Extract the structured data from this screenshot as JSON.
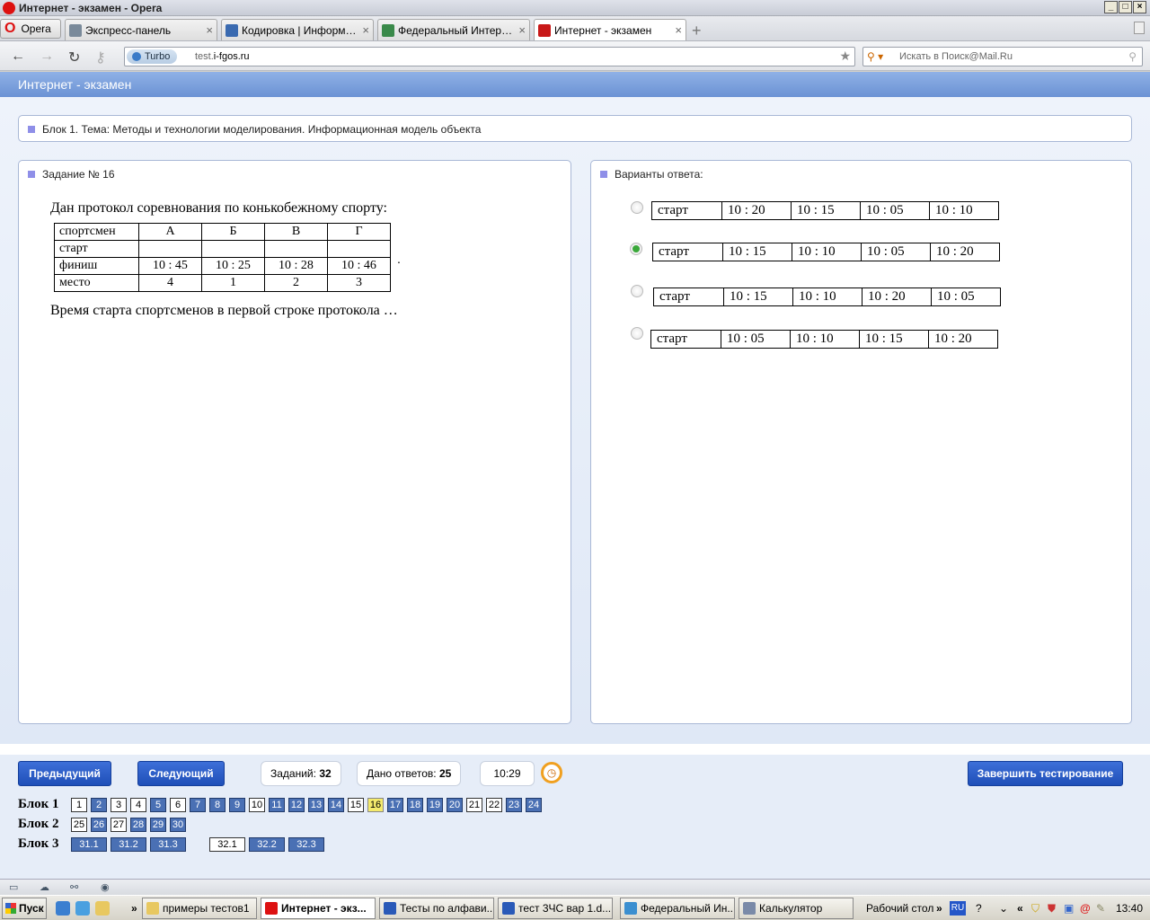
{
  "window": {
    "title": "Интернет - экзамен - Opera"
  },
  "browser": {
    "menu_label": "Opera",
    "tabs": [
      {
        "label": "Экспресс-панель",
        "icon": "grid-icon"
      },
      {
        "label": "Кодировка | Информат...",
        "icon": "site-icon"
      },
      {
        "label": "Федеральный Интерне...",
        "icon": "site-icon"
      },
      {
        "label": "Интернет - экзамен",
        "icon": "site-icon",
        "active": true
      }
    ],
    "turbo_label": "Turbo",
    "url_prefix": "test.",
    "url_domain": "i-fgos.ru",
    "search_placeholder": "Искать в Поиск@Mail.Ru"
  },
  "page": {
    "header_title": "Интернет - экзамен",
    "block_title": "Блок 1. Тема: Методы и технологии моделирования. Информационная модель объекта",
    "task_title": "Задание № 16",
    "question_intro": "Дан протокол соревнования по конькобежному спорту:",
    "protocol": {
      "header": [
        "спортсмен",
        "А",
        "Б",
        "В",
        "Г"
      ],
      "rows": [
        [
          "старт",
          "",
          "",
          "",
          ""
        ],
        [
          "финиш",
          "10 : 45",
          "10 : 25",
          "10 : 28",
          "10 : 46"
        ],
        [
          "место",
          "4",
          "1",
          "2",
          "3"
        ]
      ],
      "trailing_dot": "."
    },
    "question_text": "Время старта спортсменов в первой строке протокола …",
    "answers_title": "Варианты ответа:",
    "answers": [
      {
        "selected": false,
        "cells": [
          "старт",
          "10 : 20",
          "10 : 15",
          "10 : 05",
          "10 : 10"
        ]
      },
      {
        "selected": true,
        "cells": [
          "старт",
          "10 : 15",
          "10 : 10",
          "10 : 05",
          "10 : 20"
        ]
      },
      {
        "selected": false,
        "cells": [
          "старт",
          "10 : 15",
          "10 : 10",
          "10 : 20",
          "10 : 05"
        ]
      },
      {
        "selected": false,
        "cells": [
          "старт",
          "10 : 05",
          "10 : 10",
          "10 : 15",
          "10 : 20"
        ]
      }
    ],
    "controls": {
      "prev_label": "Предыдущий",
      "next_label": "Следующий",
      "tasks_label": "Заданий:",
      "tasks_count": "32",
      "answered_label": "Дано ответов:",
      "answered_count": "25",
      "timer": "10:29",
      "finish_label": "Завершить тестирование"
    },
    "blocks": [
      {
        "label": "Блок 1",
        "items": [
          {
            "n": "1",
            "s": "unans"
          },
          {
            "n": "2",
            "s": "ans"
          },
          {
            "n": "3",
            "s": "unans"
          },
          {
            "n": "4",
            "s": "unans"
          },
          {
            "n": "5",
            "s": "ans"
          },
          {
            "n": "6",
            "s": "unans"
          },
          {
            "n": "7",
            "s": "ans"
          },
          {
            "n": "8",
            "s": "ans"
          },
          {
            "n": "9",
            "s": "ans"
          },
          {
            "n": "10",
            "s": "unans"
          },
          {
            "n": "11",
            "s": "ans"
          },
          {
            "n": "12",
            "s": "ans"
          },
          {
            "n": "13",
            "s": "ans"
          },
          {
            "n": "14",
            "s": "ans"
          },
          {
            "n": "15",
            "s": "unans"
          },
          {
            "n": "16",
            "s": "cur"
          },
          {
            "n": "17",
            "s": "ans"
          },
          {
            "n": "18",
            "s": "ans"
          },
          {
            "n": "19",
            "s": "ans"
          },
          {
            "n": "20",
            "s": "ans"
          },
          {
            "n": "21",
            "s": "unans"
          },
          {
            "n": "22",
            "s": "unans"
          },
          {
            "n": "23",
            "s": "ans"
          },
          {
            "n": "24",
            "s": "ans"
          }
        ]
      },
      {
        "label": "Блок 2",
        "items": [
          {
            "n": "25",
            "s": "unans"
          },
          {
            "n": "26",
            "s": "ans"
          },
          {
            "n": "27",
            "s": "unans"
          },
          {
            "n": "28",
            "s": "ans"
          },
          {
            "n": "29",
            "s": "ans"
          },
          {
            "n": "30",
            "s": "ans"
          }
        ]
      },
      {
        "label": "Блок 3",
        "items": [
          {
            "n": "31.1",
            "s": "ans"
          },
          {
            "n": "31.2",
            "s": "ans"
          },
          {
            "n": "31.3",
            "s": "ans"
          },
          {
            "n": "32.1",
            "s": "unans",
            "gap": true
          },
          {
            "n": "32.2",
            "s": "ans"
          },
          {
            "n": "32.3",
            "s": "ans"
          }
        ]
      }
    ]
  },
  "taskbar": {
    "start_label": "Пуск",
    "more": "»",
    "tasks": [
      {
        "label": "примеры тестов1",
        "color": "#e8c860"
      },
      {
        "label": "Интернет - экз...",
        "color": "#d11",
        "active": true
      },
      {
        "label": "Тесты по алфави...",
        "color": "#2a5ab8"
      },
      {
        "label": "тест 3ЧС вар 1.d...",
        "color": "#2a5ab8"
      },
      {
        "label": "Федеральный Ин...",
        "color": "#3b8fd0"
      },
      {
        "label": "Калькулятор",
        "color": "#7a8aa8"
      }
    ],
    "desktop_label": "Рабочий стол",
    "lang": "RU",
    "clock": "13:40"
  }
}
